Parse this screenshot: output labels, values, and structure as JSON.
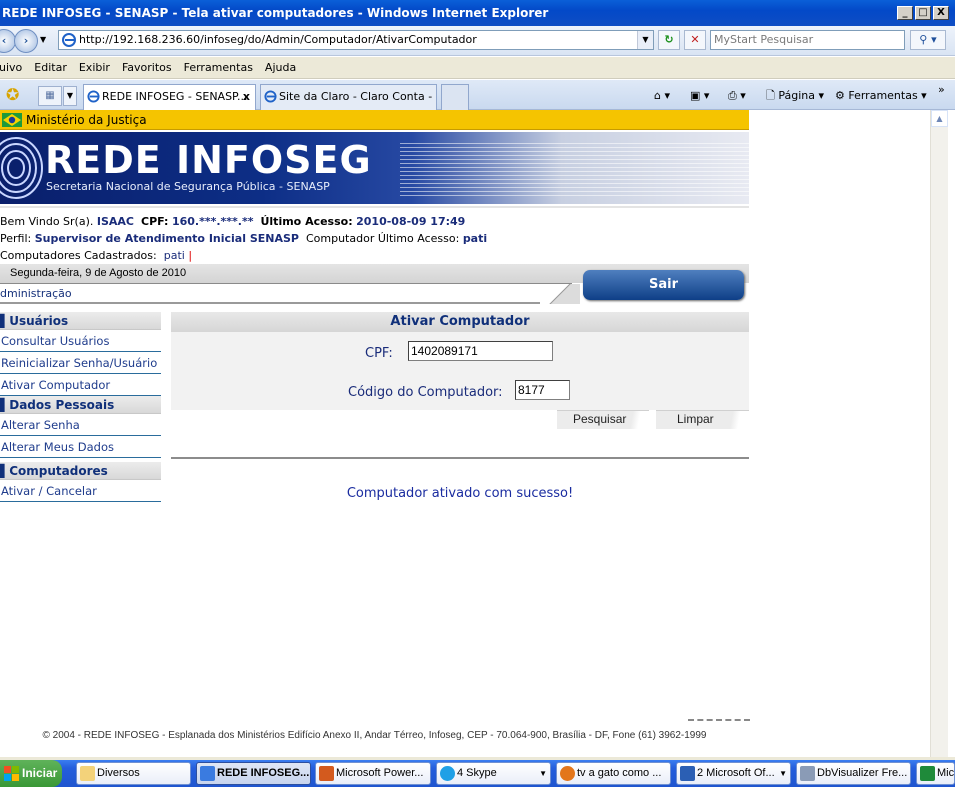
{
  "window": {
    "title": "REDE INFOSEG - SENASP - Tela ativar computadores - Windows Internet Explorer",
    "minimize": "_",
    "maximize": "□",
    "close": "X"
  },
  "address": {
    "url": "http://192.168.236.60/infoseg/do/Admin/Computador/AtivarComputador",
    "search_placeholder": "MyStart Pesquisar"
  },
  "menu": [
    "uivo",
    "Editar",
    "Exibir",
    "Favoritos",
    "Ferramentas",
    "Ajuda"
  ],
  "tabs": [
    {
      "label": "REDE INFOSEG - SENASP...",
      "close": "x"
    },
    {
      "label": "Site da Claro - Claro Conta - ..."
    }
  ],
  "commandbar": {
    "page": "Página",
    "tools": "Ferramentas",
    "more": "»"
  },
  "site": {
    "ministry": "Ministério da Justiça",
    "logo_title": "REDE INFOSEG",
    "logo_subtitle": "Secretaria Nacional de Segurança Pública - SENASP",
    "welcome_label": "Bem Vindo Sr(a).",
    "user": "ISAAC",
    "cpf_label": "CPF:",
    "cpf_masked": "160.***.***.**",
    "last_access_label": "Último Acesso:",
    "last_access": "2010-08-09 17:49",
    "profile_label": "Perfil:",
    "profile": "Supervisor de Atendimento Inicial SENASP",
    "last_computer_label": "Computador Último Acesso:",
    "last_computer": "pati",
    "registered_label": "Computadores Cadastrados:",
    "registered": "pati",
    "registered_sep": "|",
    "date": "Segunda-feira, 9 de Agosto de 2010",
    "section": "dministração",
    "logout": "Sair"
  },
  "sidebar": {
    "sections": [
      {
        "title": "Usuários",
        "items": [
          "Consultar Usuários",
          "Reinicializar Senha/Usuário",
          "Ativar Computador"
        ]
      },
      {
        "title": "Dados Pessoais",
        "items": [
          "Alterar Senha",
          "Alterar Meus Dados"
        ]
      },
      {
        "title": "Computadores",
        "items": [
          "Ativar / Cancelar"
        ]
      }
    ]
  },
  "form": {
    "title": "Ativar Computador",
    "cpf_label": "CPF:",
    "cpf_value": "1402089171",
    "code_label": "Código do Computador:",
    "code_value": "8177",
    "search_button": "Pesquisar",
    "clear_button": "Limpar",
    "success": "Computador ativado com sucesso!"
  },
  "footer": "© 2004 - REDE INFOSEG - Esplanada dos Ministérios Edifício Anexo II, Andar Térreo, Infoseg, CEP - 70.064-900, Brasília - DF, Fone (61) 3962-1999",
  "taskbar": {
    "start": "Iniciar",
    "items": [
      {
        "label": "Diversos"
      },
      {
        "label": "REDE INFOSEG..."
      },
      {
        "label": "Microsoft Power..."
      },
      {
        "label": "4 Skype"
      },
      {
        "label": "tv a gato como ..."
      },
      {
        "label": "2 Microsoft Of..."
      },
      {
        "label": "DbVisualizer Fre..."
      },
      {
        "label": "Mic"
      }
    ]
  },
  "colors": {
    "accent": "#10307a",
    "ministry_bar": "#f5c400",
    "logout_button": "#0e3f87",
    "success_text": "#1a2ca0"
  }
}
